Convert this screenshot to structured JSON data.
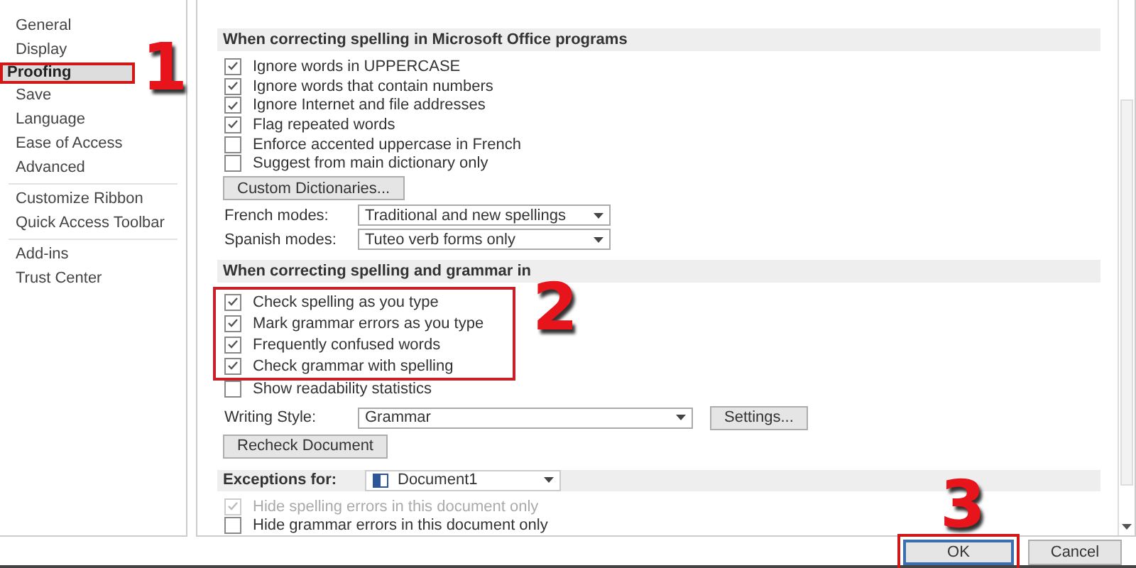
{
  "sidebar": {
    "items": [
      {
        "label": "General",
        "selected": false,
        "highlighted": false
      },
      {
        "label": "Display",
        "selected": false,
        "highlighted": false
      },
      {
        "label": "Proofing",
        "selected": true,
        "highlighted": true,
        "annotation": "1"
      },
      {
        "label": "Save",
        "selected": false,
        "highlighted": false
      },
      {
        "label": "Language",
        "selected": false,
        "highlighted": false
      },
      {
        "label": "Ease of Access",
        "selected": false,
        "highlighted": false
      },
      {
        "label": "Advanced",
        "selected": false,
        "highlighted": false,
        "divider_after": true
      },
      {
        "label": "Customize Ribbon",
        "selected": false,
        "highlighted": false
      },
      {
        "label": "Quick Access Toolbar",
        "selected": false,
        "highlighted": false,
        "divider_after": true
      },
      {
        "label": "Add-ins",
        "selected": false,
        "highlighted": false
      },
      {
        "label": "Trust Center",
        "selected": false,
        "highlighted": false
      }
    ]
  },
  "sections": [
    {
      "kind": "group",
      "title": "When correcting spelling in Microsoft Office programs",
      "rows": [
        {
          "kind": "checkbox",
          "label": "Ignore words in UPPERCASE",
          "checked": true,
          "disabled": false
        },
        {
          "kind": "checkbox",
          "label": "Ignore words that contain numbers",
          "checked": true,
          "disabled": false
        },
        {
          "kind": "checkbox",
          "label": "Ignore Internet and file addresses",
          "checked": true,
          "disabled": false
        },
        {
          "kind": "checkbox",
          "label": "Flag repeated words",
          "checked": true,
          "disabled": false
        },
        {
          "kind": "checkbox",
          "label": "Enforce accented uppercase in French",
          "checked": false,
          "disabled": false
        },
        {
          "kind": "checkbox",
          "label": "Suggest from main dictionary only",
          "checked": false,
          "disabled": false
        },
        {
          "kind": "button",
          "label": "Custom Dictionaries..."
        },
        {
          "kind": "select",
          "label": "French modes:",
          "value": "Traditional and new spellings"
        },
        {
          "kind": "select",
          "label": "Spanish modes:",
          "value": "Tuteo verb forms only"
        }
      ]
    },
    {
      "kind": "group",
      "title": "When correcting spelling and grammar in",
      "rows": [
        {
          "kind": "highlight",
          "annotation": "2",
          "rows": [
            {
              "kind": "checkbox",
              "label": "Check spelling as you type",
              "checked": true,
              "disabled": false
            },
            {
              "kind": "checkbox",
              "label": "Mark grammar errors as you type",
              "checked": true,
              "disabled": false
            },
            {
              "kind": "checkbox",
              "label": "Frequently confused words",
              "checked": true,
              "disabled": false
            },
            {
              "kind": "checkbox",
              "label": "Check grammar with spelling",
              "checked": true,
              "disabled": false
            }
          ]
        },
        {
          "kind": "checkbox",
          "label": "Show readability statistics",
          "checked": false,
          "disabled": false
        },
        {
          "kind": "select",
          "label": "Writing Style:",
          "value": "Grammar",
          "button": "Settings..."
        },
        {
          "kind": "button",
          "label": "Recheck Document"
        }
      ]
    },
    {
      "kind": "exceptions",
      "title": "Exceptions for:",
      "value": "Document1",
      "rows": [
        {
          "kind": "checkbox",
          "label": "Hide spelling errors in this document only",
          "checked": true,
          "disabled": true
        },
        {
          "kind": "checkbox",
          "label": "Hide grammar errors in this document only",
          "checked": false,
          "disabled": false
        }
      ]
    }
  ],
  "buttons": [
    {
      "label": "OK",
      "default": true,
      "highlighted": true,
      "annotation": "3"
    },
    {
      "label": "Cancel",
      "default": false,
      "highlighted": false
    }
  ]
}
